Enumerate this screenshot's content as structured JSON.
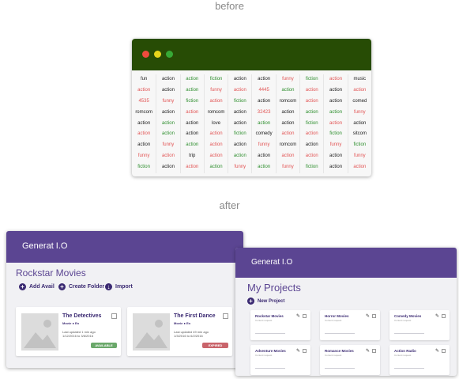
{
  "labels": {
    "before": "before",
    "after": "after"
  },
  "old_app": {
    "colors": {
      "titlebar": "#274c05",
      "close": "#ef4b3e",
      "min": "#e6d41b",
      "max": "#37a936"
    },
    "rows": [
      [
        [
          "fun",
          "k"
        ],
        [
          "action",
          "k"
        ],
        [
          "action",
          "g"
        ],
        [
          "fiction",
          "g"
        ],
        [
          "action",
          "k"
        ],
        [
          "action",
          "k"
        ],
        [
          "funny",
          "r"
        ],
        [
          "fiction",
          "g"
        ],
        [
          "action",
          "r"
        ],
        [
          "music",
          "k"
        ]
      ],
      [
        [
          "action",
          "r"
        ],
        [
          "action",
          "k"
        ],
        [
          "action",
          "g"
        ],
        [
          "funny",
          "r"
        ],
        [
          "action",
          "r"
        ],
        [
          "4445",
          "r"
        ],
        [
          "action",
          "g"
        ],
        [
          "action",
          "r"
        ],
        [
          "action",
          "k"
        ],
        [
          "action",
          "r"
        ]
      ],
      [
        [
          "4535",
          "r"
        ],
        [
          "funny",
          "r"
        ],
        [
          "fiction",
          "g"
        ],
        [
          "action",
          "r"
        ],
        [
          "fiction",
          "g"
        ],
        [
          "action",
          "k"
        ],
        [
          "romcom",
          "k"
        ],
        [
          "action",
          "r"
        ],
        [
          "action",
          "k"
        ],
        [
          "comed",
          "k"
        ]
      ],
      [
        [
          "romcom",
          "k"
        ],
        [
          "action",
          "k"
        ],
        [
          "action",
          "r"
        ],
        [
          "romcom",
          "k"
        ],
        [
          "action",
          "k"
        ],
        [
          "32423",
          "r"
        ],
        [
          "action",
          "k"
        ],
        [
          "action",
          "g"
        ],
        [
          "action",
          "g"
        ],
        [
          "funny",
          "r"
        ]
      ],
      [
        [
          "action",
          "k"
        ],
        [
          "action",
          "g"
        ],
        [
          "action",
          "k"
        ],
        [
          "love",
          "k"
        ],
        [
          "action",
          "k"
        ],
        [
          "action",
          "g"
        ],
        [
          "action",
          "k"
        ],
        [
          "fiction",
          "g"
        ],
        [
          "action",
          "r"
        ],
        [
          "action",
          "k"
        ]
      ],
      [
        [
          "action",
          "r"
        ],
        [
          "action",
          "g"
        ],
        [
          "action",
          "k"
        ],
        [
          "action",
          "r"
        ],
        [
          "fiction",
          "g"
        ],
        [
          "comedy",
          "k"
        ],
        [
          "action",
          "r"
        ],
        [
          "action",
          "r"
        ],
        [
          "fiction",
          "g"
        ],
        [
          "sitcom",
          "k"
        ]
      ],
      [
        [
          "action",
          "k"
        ],
        [
          "funny",
          "r"
        ],
        [
          "action",
          "g"
        ],
        [
          "action",
          "r"
        ],
        [
          "action",
          "k"
        ],
        [
          "funny",
          "r"
        ],
        [
          "romcom",
          "k"
        ],
        [
          "action",
          "k"
        ],
        [
          "funny",
          "r"
        ],
        [
          "fiction",
          "g"
        ]
      ],
      [
        [
          "funny",
          "r"
        ],
        [
          "action",
          "r"
        ],
        [
          "trip",
          "k"
        ],
        [
          "action",
          "r"
        ],
        [
          "action",
          "g"
        ],
        [
          "action",
          "k"
        ],
        [
          "action",
          "r"
        ],
        [
          "action",
          "r"
        ],
        [
          "action",
          "k"
        ],
        [
          "funny",
          "r"
        ]
      ],
      [
        [
          "fiction",
          "g"
        ],
        [
          "action",
          "k"
        ],
        [
          "action",
          "r"
        ],
        [
          "action",
          "g"
        ],
        [
          "funny",
          "r"
        ],
        [
          "action",
          "g"
        ],
        [
          "funny",
          "r"
        ],
        [
          "fiction",
          "g"
        ],
        [
          "action",
          "k"
        ],
        [
          "action",
          "r"
        ]
      ]
    ]
  },
  "app1": {
    "brand": "Generat I.O",
    "title": "Rockstar Movies",
    "actions": [
      "Add Avail",
      "Create Folder",
      "Import"
    ],
    "cards": [
      {
        "title": "The Detectives",
        "type": "Movie",
        "lang": "En",
        "updated": "Last updated 1 min ago",
        "range": "1/12/2016 to 3/6/2016",
        "badge": "AVAILABLE",
        "badge_color": "#6aa86a"
      },
      {
        "title": "The First Dance",
        "type": "Movie",
        "lang": "En",
        "updated": "Last updated 49 min ago",
        "range": "1/3/2016 to 6/2/2016",
        "badge": "EXPIRED",
        "badge_color": "#c9646b"
      }
    ]
  },
  "app2": {
    "brand": "Generat I.O",
    "title": "My Projects",
    "new_project": "New Project",
    "projects": [
      {
        "name": "Rockstar Movies",
        "sub": "Content request"
      },
      {
        "name": "Horror Movies",
        "sub": "Content request"
      },
      {
        "name": "Comedy Movies",
        "sub": "Content request"
      },
      {
        "name": "Adventure Movies",
        "sub": "Content request"
      },
      {
        "name": "Romance Movies",
        "sub": "Content request"
      },
      {
        "name": "Action Radio",
        "sub": "Content request"
      }
    ]
  }
}
